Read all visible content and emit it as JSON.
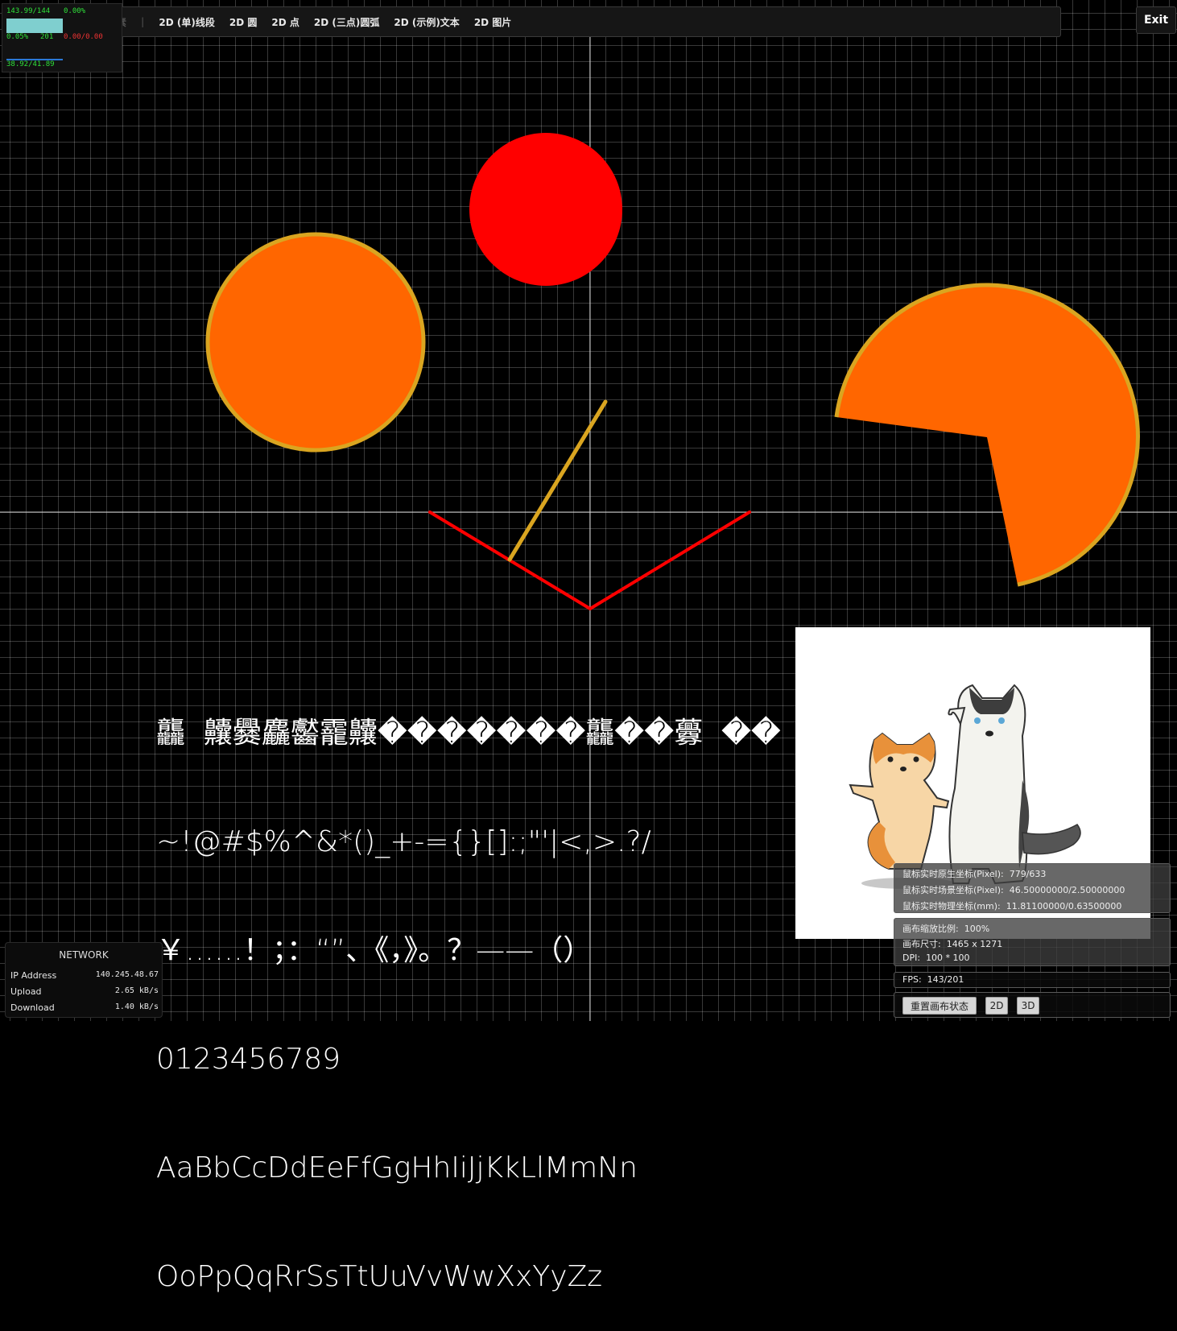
{
  "toolbar": {
    "items": [
      {
        "label": "元素",
        "dim": true
      },
      {
        "label": "2D (单)线段"
      },
      {
        "label": "2D 圆"
      },
      {
        "label": "2D 点"
      },
      {
        "label": "2D (三点)圆弧"
      },
      {
        "label": "2D (示例)文本"
      },
      {
        "label": "2D 图片"
      }
    ]
  },
  "exit": {
    "label": "Exit"
  },
  "perf": {
    "fps_ratio": "143.99/144",
    "pct1": "0.00%",
    "pct2": "0.05%",
    "count": "201",
    "mem": "0.00/0.00",
    "time": "38.92/41.89"
  },
  "colors": {
    "red": "#ff0000",
    "orange": "#ff6600",
    "gold": "#daa520",
    "axis": "#d0d0d0"
  },
  "text_sample": {
    "lines": [
      "龘  齉爨麤齾靇齉�������龘��虋  ��",
      "~!@#$%^&*()_+-={}[]:;\"'|<,>.?/",
      "￥……！；：“”、《，》。？——（）",
      "0123456789",
      "AaBbCcDdEeFfGgHhIiJjKkLlMmNn",
      "OoPpQqRrSsTtUuVvWwXxYyZz"
    ]
  },
  "network": {
    "title": "NETWORK",
    "ip_label": "IP Address",
    "ip_value": "140.245.48.67",
    "upload_label": "Upload",
    "upload_value": "2.65 kB/s",
    "download_label": "Download",
    "download_value": "1.40 kB/s"
  },
  "coords": {
    "raw_label": "鼠标实时原生坐标(Pixel):",
    "raw_value": "779/633",
    "scene_label": "鼠标实时场景坐标(Pixel):",
    "scene_value": "46.50000000/2.50000000",
    "phys_label": "鼠标实时物理坐标(mm):",
    "phys_value": "11.81100000/0.63500000"
  },
  "canvas_info": {
    "zoom_label": "画布缩放比例:",
    "zoom_value": "100%",
    "size_label": "画布尺寸:",
    "size_value": "1465 x 1271",
    "dpi_label": "DPI:",
    "dpi_value": "100 * 100"
  },
  "fps": {
    "label": "FPS:",
    "value": "143/201"
  },
  "buttons": {
    "reset": "重置画布状态",
    "b2d": "2D",
    "b3d": "3D"
  }
}
